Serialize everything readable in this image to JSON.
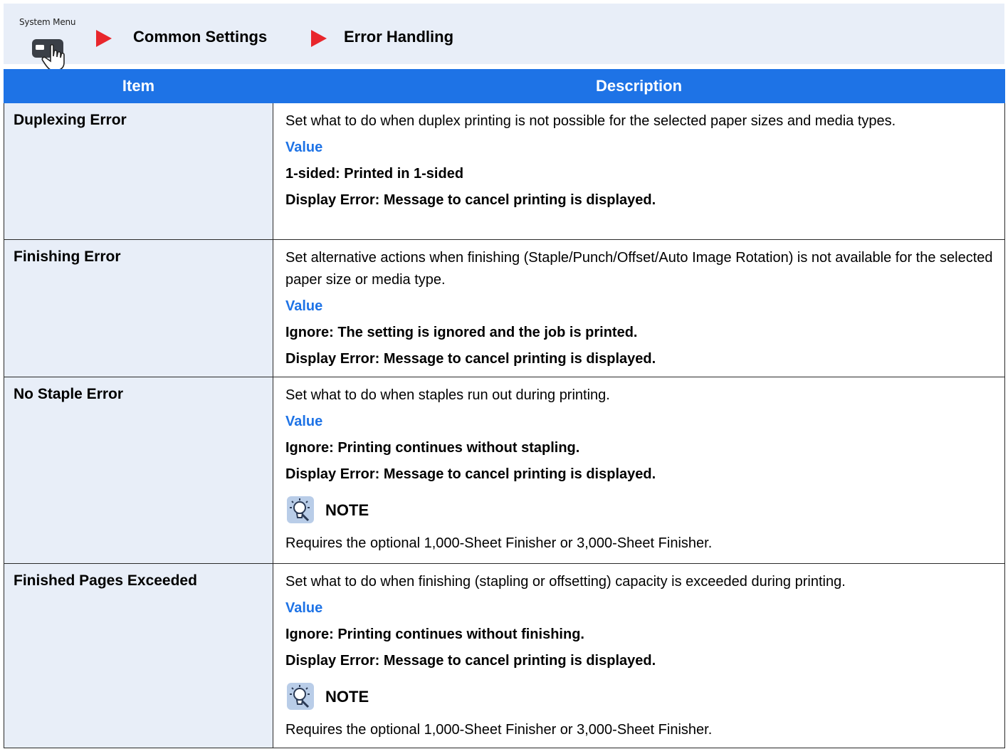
{
  "header": {
    "system_menu_label": "System Menu",
    "crumbs": [
      "Common Settings",
      "Error Handling"
    ]
  },
  "table": {
    "columns": [
      "Item",
      "Description"
    ],
    "rows": [
      {
        "item": "Duplexing Error",
        "description": "Set what to do when duplex printing is not possible for the selected paper sizes and media types.",
        "value_label": "Value",
        "options": [
          "1-sided: Printed in 1-sided",
          "Display Error: Message to cancel printing is displayed."
        ]
      },
      {
        "item": "Finishing Error",
        "description": "Set alternative actions when finishing (Staple/Punch/Offset/Auto Image Rotation) is not available for the selected paper size or media type.",
        "value_label": "Value",
        "options": [
          "Ignore: The setting is ignored and the job is printed.",
          "Display Error: Message to cancel printing is displayed."
        ]
      },
      {
        "item": "No Staple Error",
        "description": "Set what to do when staples run out during printing.",
        "value_label": "Value",
        "options": [
          "Ignore: Printing continues without stapling.",
          "Display Error: Message to cancel printing is displayed."
        ],
        "note_label": "NOTE",
        "note": "Requires the optional 1,000-Sheet Finisher or 3,000-Sheet Finisher."
      },
      {
        "item": "Finished Pages Exceeded",
        "description": "Set what to do when finishing (stapling or offsetting) capacity is exceeded during printing.",
        "value_label": "Value",
        "options": [
          "Ignore: Printing continues without finishing.",
          "Display Error: Message to cancel printing is displayed."
        ],
        "note_label": "NOTE",
        "note": "Requires the optional 1,000-Sheet Finisher or 3,000-Sheet Finisher."
      }
    ]
  },
  "colors": {
    "accent": "#1e73e6",
    "header_bg": "#e8eef8",
    "arrow": "#e8262c"
  },
  "icons": {
    "system_menu": "hand-pointer-icon",
    "breadcrumb": "triangle-right-icon",
    "note": "lightbulb-icon"
  }
}
